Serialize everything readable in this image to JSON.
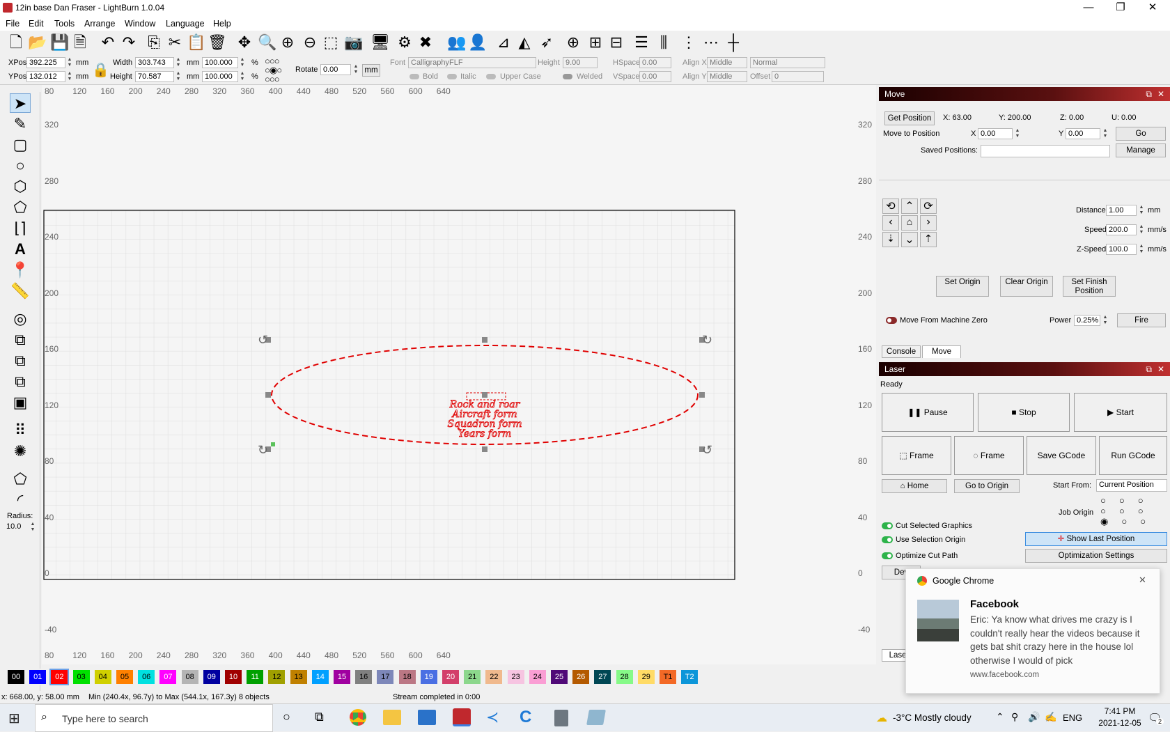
{
  "window": {
    "title": "12in base Dan Fraser - LightBurn 1.0.04",
    "minimize": "—",
    "maximize": "❐",
    "close": "✕"
  },
  "menu": [
    "File",
    "Edit",
    "Tools",
    "Arrange",
    "Window",
    "Language",
    "Help"
  ],
  "props": {
    "xpos_label": "XPos",
    "xpos": "392.225",
    "ypos_label": "YPos",
    "ypos": "132.012",
    "unit": "mm",
    "width_label": "Width",
    "width": "303.743",
    "height_label": "Height",
    "height": "70.587",
    "wpct": "100.000",
    "hpct": "100.000",
    "pct": "%",
    "rotate_label": "Rotate",
    "rotate": "0.00",
    "mm_btn": "mm",
    "font_label": "Font",
    "font": "CalligraphyFLF",
    "theight_label": "Height",
    "theight": "9.00",
    "hspace_label": "HSpace",
    "hspace": "0.00",
    "vspace_label": "VSpace",
    "vspace": "0.00",
    "alignx_label": "Align X",
    "alignx": "Middle",
    "aligny_label": "Align Y",
    "aligny": "Middle",
    "normal": "Normal",
    "offset_label": "Offset",
    "offset": "0",
    "bold": "Bold",
    "italic": "Italic",
    "upper": "Upper Case",
    "welded": "Welded"
  },
  "rulers": {
    "top": [
      "80",
      "120",
      "160",
      "200",
      "240",
      "280",
      "320",
      "360",
      "400",
      "440",
      "480",
      "520",
      "560",
      "600",
      "640"
    ],
    "left": [
      "320",
      "280",
      "240",
      "200",
      "160",
      "120",
      "80",
      "40",
      "0",
      "-40"
    ],
    "right": [
      "320",
      "280",
      "240",
      "200",
      "160",
      "120",
      "80",
      "40",
      "0",
      "-40"
    ]
  },
  "canvas_text": [
    "Rock and roar",
    "Aircraft form",
    "Squadron form",
    "Years form"
  ],
  "radius": {
    "label": "Radius:",
    "value": "10.0"
  },
  "move": {
    "title": "Move",
    "get_position": "Get Position",
    "x": "X: 63.00",
    "y": "Y: 200.00",
    "z": "Z: 0.00",
    "u": "U: 0.00",
    "move_to": "Move to Position",
    "mx_label": "X",
    "mx": "0.00",
    "my_label": "Y",
    "my": "0.00",
    "go": "Go",
    "saved": "Saved Positions:",
    "manage": "Manage",
    "distance_label": "Distance",
    "distance": "1.00",
    "distance_unit": "mm",
    "speed_label": "Speed",
    "speed": "200.0",
    "speed_unit": "mm/s",
    "zspeed_label": "Z-Speed",
    "zspeed": "100.0",
    "zspeed_unit": "mm/s",
    "set_origin": "Set Origin",
    "clear_origin": "Clear Origin",
    "set_finish": "Set Finish Position",
    "machine_zero": "Move From Machine Zero",
    "power_label": "Power",
    "power": "0.25%",
    "fire": "Fire"
  },
  "tabs": {
    "console": "Console",
    "move": "Move"
  },
  "laser": {
    "title": "Laser",
    "status": "Ready",
    "pause": "Pause",
    "stop": "Stop",
    "start": "Start",
    "frame1": "Frame",
    "frame2": "Frame",
    "save_gcode": "Save GCode",
    "run_gcode": "Run GCode",
    "home": "Home",
    "go_origin": "Go to Origin",
    "start_from_label": "Start From:",
    "start_from": "Current Position",
    "job_origin": "Job Origin",
    "cut_selected": "Cut Selected Graphics",
    "use_selection": "Use Selection Origin",
    "optimize": "Optimize Cut Path",
    "show_last": "Show Last Position",
    "opt_settings": "Optimization Settings",
    "devices": "Dev",
    "laser_tab": "Laser"
  },
  "palette": [
    {
      "l": "00",
      "c": "#000000",
      "t": "#ffffff"
    },
    {
      "l": "01",
      "c": "#0000ff",
      "t": "#ffffff"
    },
    {
      "l": "02",
      "c": "#ff0000",
      "t": "#ffffff"
    },
    {
      "l": "03",
      "c": "#00e000",
      "t": "#000000"
    },
    {
      "l": "04",
      "c": "#d0d000",
      "t": "#000000"
    },
    {
      "l": "05",
      "c": "#ff8000",
      "t": "#000000"
    },
    {
      "l": "06",
      "c": "#00e0e0",
      "t": "#000000"
    },
    {
      "l": "07",
      "c": "#ff00ff",
      "t": "#ffffff"
    },
    {
      "l": "08",
      "c": "#b4b4b4",
      "t": "#000000"
    },
    {
      "l": "09",
      "c": "#0000a0",
      "t": "#ffffff"
    },
    {
      "l": "10",
      "c": "#a00000",
      "t": "#ffffff"
    },
    {
      "l": "11",
      "c": "#00a000",
      "t": "#ffffff"
    },
    {
      "l": "12",
      "c": "#a0a000",
      "t": "#000000"
    },
    {
      "l": "13",
      "c": "#c08000",
      "t": "#000000"
    },
    {
      "l": "14",
      "c": "#00a0ff",
      "t": "#ffffff"
    },
    {
      "l": "15",
      "c": "#a000a0",
      "t": "#ffffff"
    },
    {
      "l": "16",
      "c": "#808080",
      "t": "#000000"
    },
    {
      "l": "17",
      "c": "#7d87b9",
      "t": "#000000"
    },
    {
      "l": "18",
      "c": "#bb7784",
      "t": "#000000"
    },
    {
      "l": "19",
      "c": "#4a6fe3",
      "t": "#ffffff"
    },
    {
      "l": "20",
      "c": "#d33f6a",
      "t": "#ffffff"
    },
    {
      "l": "21",
      "c": "#8cd78c",
      "t": "#000000"
    },
    {
      "l": "22",
      "c": "#f0b98d",
      "t": "#000000"
    },
    {
      "l": "23",
      "c": "#f6c4e1",
      "t": "#000000"
    },
    {
      "l": "24",
      "c": "#fa9ed4",
      "t": "#000000"
    },
    {
      "l": "25",
      "c": "#500a78",
      "t": "#ffffff"
    },
    {
      "l": "26",
      "c": "#b45a00",
      "t": "#ffffff"
    },
    {
      "l": "27",
      "c": "#004754",
      "t": "#ffffff"
    },
    {
      "l": "28",
      "c": "#86fa88",
      "t": "#000000"
    },
    {
      "l": "29",
      "c": "#ffdb66",
      "t": "#000000"
    },
    {
      "l": "T1",
      "c": "#f36926",
      "t": "#000000"
    },
    {
      "l": "T2",
      "c": "#0c96d9",
      "t": "#ffffff"
    }
  ],
  "status": {
    "coords": "x: 668.00, y: 58.00 mm",
    "bounds": "Min (240.4x, 96.7y) to Max (544.1x, 167.3y)  8 objects",
    "stream": "Stream completed in 0:00"
  },
  "toast": {
    "app": "Google Chrome",
    "title": "Facebook",
    "body": "Eric: Ya know what drives me crazy is I couldn't really hear the videos because it gets bat shit crazy here in the house lol otherwise I would of pick",
    "url": "www.facebook.com",
    "close": "✕"
  },
  "taskbar": {
    "search": "Type here to search",
    "weather": "-3°C  Mostly cloudy",
    "lang": "ENG",
    "time": "7:41 PM",
    "date": "2021-12-05",
    "notif": "2"
  }
}
